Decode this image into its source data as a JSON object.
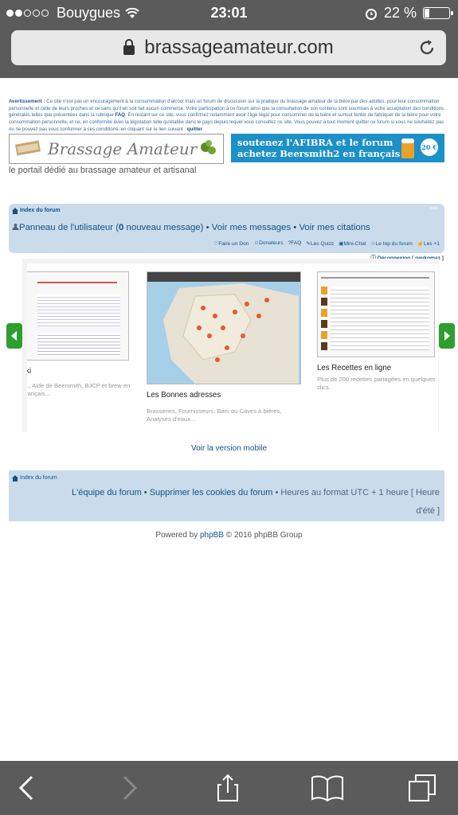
{
  "status": {
    "carrier": "Bouygues",
    "time": "23:01",
    "battery": "22 %",
    "battery_level": 0.22
  },
  "browser": {
    "url": "brassageamateur.com"
  },
  "warning": {
    "label": "Avertissement :",
    "text": "Ce site n'est pas un encouragement à la consommation d'alcool mais un forum de discussion sur la pratique du brassage amateur de la bière par des adultes, pour leur consommation personnelle et celle de leurs proches et ce sans qu'il en soit fait aucun commerce. Votre participation à ce forum ainsi que la consultation de son contenu sont soumises à votre acceptation des conditions générales telles que présentées dans la rubrique",
    "faq": "FAQ",
    "text2": ". En restant sur ce site, vous confirmez notamment avoir l'âge légal pour consommer de la bière et surtout tenter de fabriquer de la bière pour votre consommation personnelle, et ce, en conformité avec la législation telle qu'établie dans le pays depuis lequel vous consultez ce site. Vous pouvez à tout moment quitter ce forum si vous ne souhaitez pas ou ne pouvez pas vous conformer à ces conditions, en cliquant sur le lien suivant :",
    "quit": "quitter"
  },
  "logo": {
    "title": "Brassage Amateur"
  },
  "banner": {
    "line1": "soutenez l'AFIBRA et le forum",
    "line2": "achetez Beersmith2 en français",
    "price": "20 €"
  },
  "tagline": "le portail dédié au brassage amateur et artisanal",
  "nav": {
    "index": "Index du forum",
    "toggle": "^^^",
    "panel_prefix": "Panneau de l'utilisateur (",
    "panel_count": "0",
    "panel_suffix": " nouveau message)",
    "sep": " • ",
    "messages": "Voir mes messages",
    "citations": "Voir mes citations",
    "links": [
      "Faire un Don",
      "Donateurs",
      "FAQ",
      "Les Quizz",
      "Mini-Chat",
      "Le top du forum",
      "Les +1"
    ],
    "logout": "Déconnexion [ paykomaz ]"
  },
  "slides": [
    {
      "title": "iki",
      "desc": "..., Aide de Beersmith, BJCP et brew en français..."
    },
    {
      "title": "Les Bonnes adresses",
      "desc": "Brasseries, Fournisseurs, Bars ou Caves à bières, Analyses d'eaux..."
    },
    {
      "title": "Les Recettes en ligne",
      "desc": "Plus de 200 recettes partagées en quelques clics."
    }
  ],
  "mobile_link": "Voir la version mobile",
  "footer": {
    "index": "Index du forum",
    "team": "L'équipe du forum",
    "cookies": "Supprimer les cookies du forum",
    "tz1": "Heures au format UTC + 1 heure [ Heure",
    "tz2": "d'été ]"
  },
  "powered": {
    "prefix": "Powered by ",
    "php": "phpBB",
    "suffix": " © 2016 phpBB Group"
  }
}
